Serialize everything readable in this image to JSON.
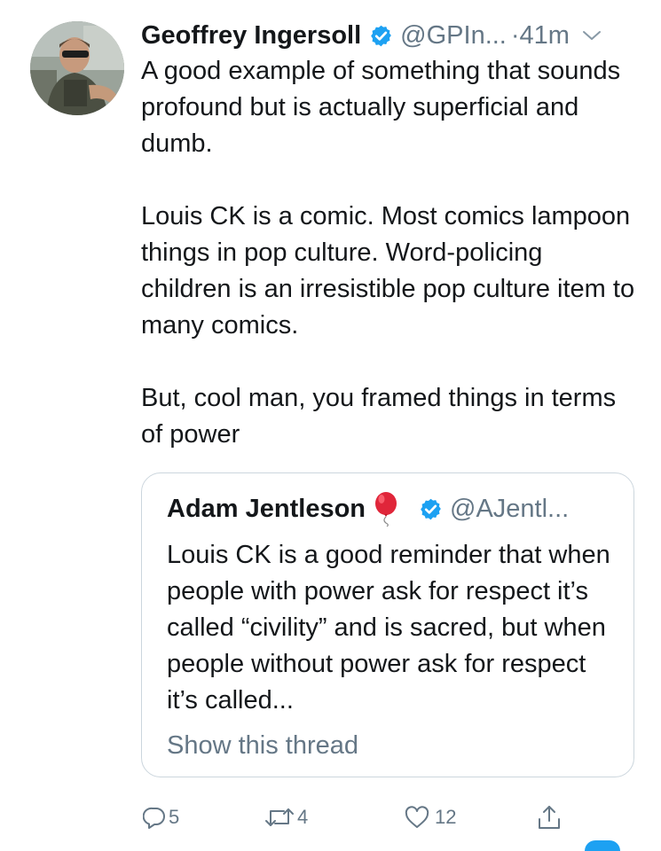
{
  "tweet": {
    "author_name": "Geoffrey Ingersoll",
    "handle": "@GPIn...",
    "separator": "·",
    "time": "41m",
    "paragraphs": [
      "A good example of something that sounds profound but is actually superficial and dumb.",
      "Louis CK is a comic. Most comics lampoon things in pop culture. Word-policing children is an irresistible pop culture item to many comics.",
      "But, cool man, you framed things in terms of power"
    ]
  },
  "quoted_tweet": {
    "author_name": "Adam Jentleson",
    "emoji": "🎈",
    "handle": "@AJentl...",
    "text": "Louis CK is a good reminder that when people with power ask for respect it’s called “civility” and is sacred, but when people without power ask for respect it’s called...",
    "show_thread": "Show this thread"
  },
  "actions": {
    "replies": "5",
    "retweets": "4",
    "likes": "12"
  },
  "colors": {
    "text": "#14171a",
    "secondary": "#657786",
    "verified_blue": "#1da1f2",
    "border": "#ccd6dd"
  },
  "icons": [
    "verified-badge-icon",
    "chevron-down-icon",
    "balloon-icon",
    "reply-icon",
    "retweet-icon",
    "like-icon",
    "share-icon"
  ]
}
